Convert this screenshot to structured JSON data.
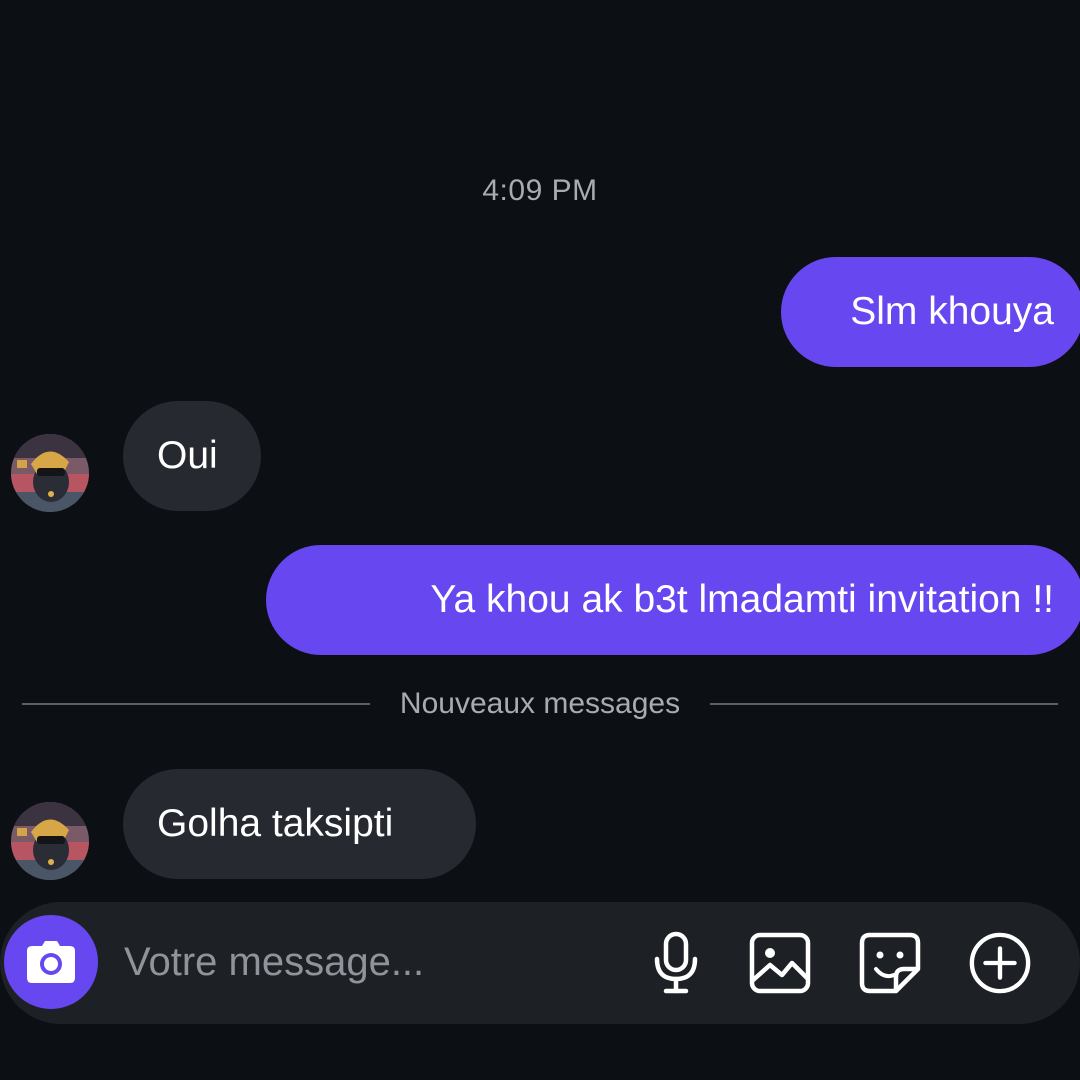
{
  "conversation": {
    "timestamp": "4:09 PM",
    "messages": [
      {
        "direction": "sent",
        "text": "Slm khouya"
      },
      {
        "direction": "received",
        "text": "Oui"
      },
      {
        "direction": "sent",
        "text": "Ya khou ak b3t lmadamti invitation !!"
      },
      {
        "direction": "received",
        "text": "Golha taksipti"
      }
    ],
    "new_messages_label": "Nouveaux messages"
  },
  "composer": {
    "placeholder": "Votre message...",
    "icons": [
      "camera-icon",
      "microphone-icon",
      "image-icon",
      "sticker-icon",
      "plus-circle-icon"
    ]
  },
  "colors": {
    "background": "#0c1014",
    "sent_bubble": "#6747f0",
    "received_bubble": "#262a30",
    "composer_bg": "#1d2125",
    "muted_text": "#a8abb1"
  }
}
